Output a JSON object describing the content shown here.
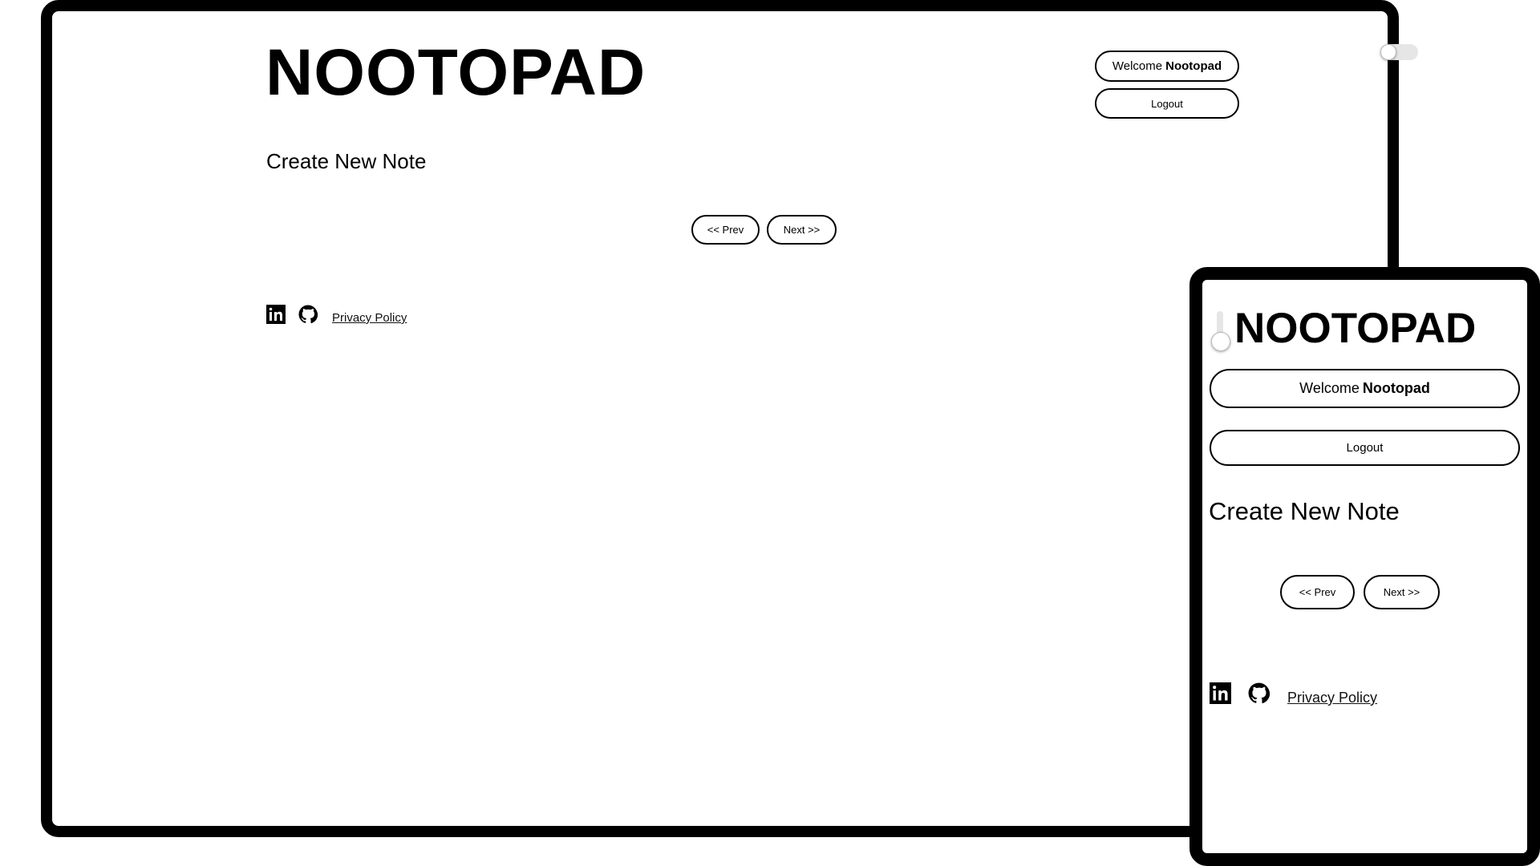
{
  "app": {
    "title": "NOOTOPAD"
  },
  "header": {
    "welcome_prefix": "Welcome",
    "username": "Nootopad",
    "logout_label": "Logout",
    "theme_toggle": {
      "icon": "toggle-switch",
      "state": "off"
    }
  },
  "main": {
    "create_note_label": "Create New Note",
    "pagination": {
      "prev_label": "<< Prev",
      "next_label": "Next >>"
    }
  },
  "footer": {
    "icons": [
      "linkedin-icon",
      "github-icon"
    ],
    "privacy_label": "Privacy Policy"
  },
  "colors": {
    "frame": "#000000",
    "background": "#ffffff",
    "toggle_track": "#e6e6e6"
  }
}
